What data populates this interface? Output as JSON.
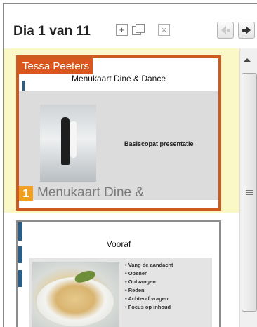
{
  "header": {
    "title": "Dia 1 van 11",
    "add_icon": "plus-icon",
    "duplicate_icon": "duplicate-icon",
    "delete_icon": "close-x-icon",
    "prev_icon": "arrow-left-icon",
    "next_icon": "arrow-right-icon"
  },
  "slides": [
    {
      "author": "Tessa Peeters",
      "title": "Menukaart Dine & Dance",
      "subtitle": "Basiscopat presentatie",
      "number": "1",
      "caption": "Menukaart Dine &",
      "selected": true
    },
    {
      "title": "Vooraf",
      "bullets": [
        "Vang de aandacht",
        "Opener",
        "Ontvangen",
        "Reden",
        "Achteraf vragen",
        "Focus op inhoud"
      ],
      "selected": false
    }
  ],
  "colors": {
    "selection_border": "#cf5a1f",
    "selection_background": "#fbf8c8",
    "author_tag": "#d8571f",
    "slide_number": "#f0a020",
    "accent_bar": "#2b5d85"
  },
  "scrollbar": {
    "up_icon": "scroll-up-arrow-icon",
    "grip_icon": "scroll-grip-icon"
  }
}
